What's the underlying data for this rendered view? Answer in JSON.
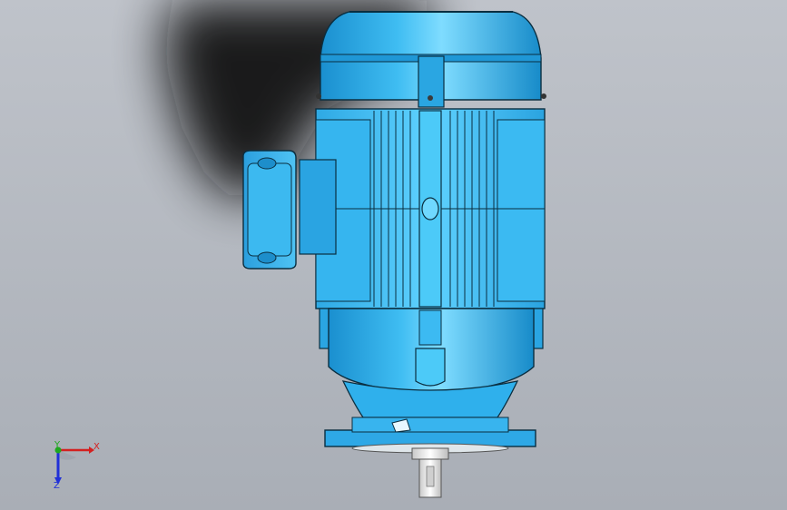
{
  "viewport": {
    "background_top": "#bfc3ca",
    "background_bottom": "#a9aeb6"
  },
  "model": {
    "name": "motor",
    "body_color": "#29a8e6",
    "highlight_color": "#6fd8ff",
    "edge_color": "#0a2e40",
    "shaft_color": "#e6e6e6"
  },
  "triad": {
    "x_label": "X",
    "y_label": "Y",
    "z_label": "Z",
    "x_color": "#d42020",
    "y_color": "#1fa81f",
    "z_color": "#2030d8"
  }
}
